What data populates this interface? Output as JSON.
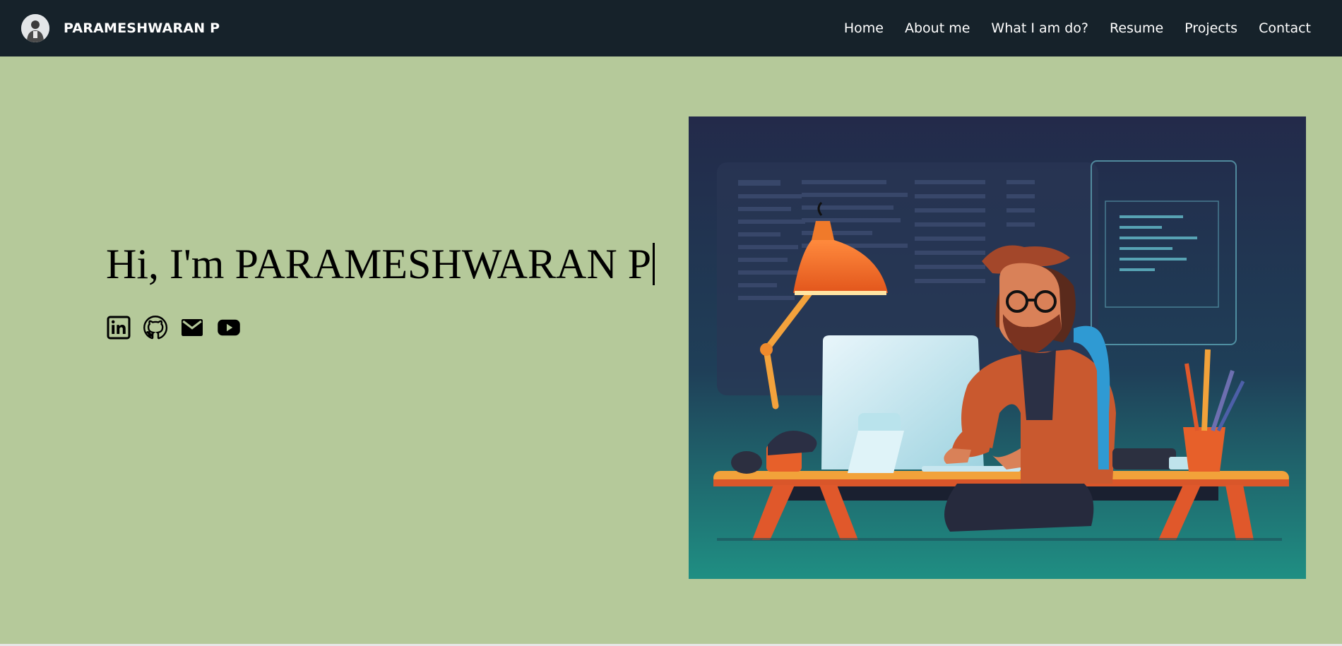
{
  "header": {
    "brand_name": "PARAMESHWARAN P",
    "avatar_icon": "user-avatar-icon",
    "nav": [
      {
        "label": "Home"
      },
      {
        "label": "About me"
      },
      {
        "label": "What I am do?"
      },
      {
        "label": "Resume"
      },
      {
        "label": "Projects"
      },
      {
        "label": "Contact"
      }
    ]
  },
  "hero": {
    "title": "Hi, I'm PARAMESHWARAN P",
    "socials": [
      {
        "icon": "linkedin-icon"
      },
      {
        "icon": "github-icon"
      },
      {
        "icon": "mail-icon"
      },
      {
        "icon": "youtube-icon"
      }
    ],
    "illustration": "developer-at-desk-illustration"
  },
  "colors": {
    "navbar_bg": "#16222a",
    "page_bg": "#b5c99a",
    "text": "#000000",
    "nav_text": "#ffffff"
  }
}
